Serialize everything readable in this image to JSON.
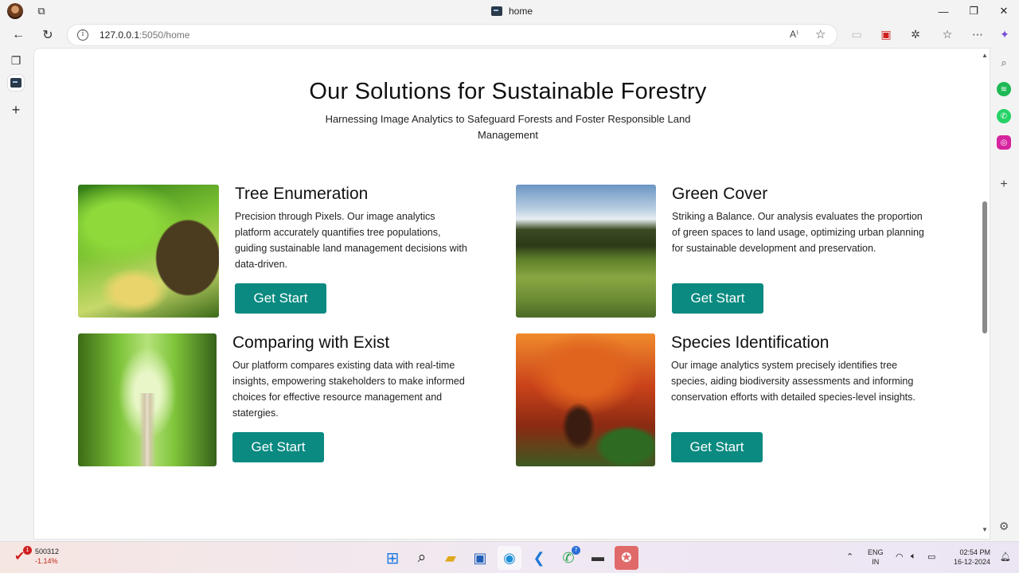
{
  "browser": {
    "tab_title": "home",
    "url_host": "127.0.0.1",
    "url_rest": ":5050/home",
    "read_aloud": "A⁾"
  },
  "page": {
    "title": "Our Solutions for Sustainable Forestry",
    "subtitle": "Harnessing Image Analytics to Safeguard Forests and Foster Responsible Land Management"
  },
  "cards": [
    {
      "title": "Tree Enumeration",
      "description": "Precision through Pixels. Our image analytics platform accurately quantifies tree populations, guiding sustainable land management decisions with data-driven.",
      "button": "Get Start"
    },
    {
      "title": "Green Cover",
      "description": "Striking a Balance. Our analysis evaluates the proportion of green spaces to land usage, optimizing urban planning for sustainable development and preservation.",
      "button": "Get Start"
    },
    {
      "title": "Comparing with Exist",
      "description": "Our platform compares existing data with real-time insights, empowering stakeholders to make informed choices for effective resource management and statergies.",
      "button": "Get Start"
    },
    {
      "title": "Species Identification",
      "description": "Our image analytics system precisely identifies tree species, aiding biodiversity assessments and informing conservation efforts with detailed species-level insights.",
      "button": "Get Start"
    }
  ],
  "taskbar": {
    "stock_value": "500312",
    "stock_change": "-1.14%",
    "stock_badge": "1",
    "whatsapp_badge": "7",
    "lang_line1": "ENG",
    "lang_line2": "IN",
    "time": "02:54 PM",
    "date": "16-12-2024"
  },
  "colors": {
    "accent": "#0a8a80"
  }
}
